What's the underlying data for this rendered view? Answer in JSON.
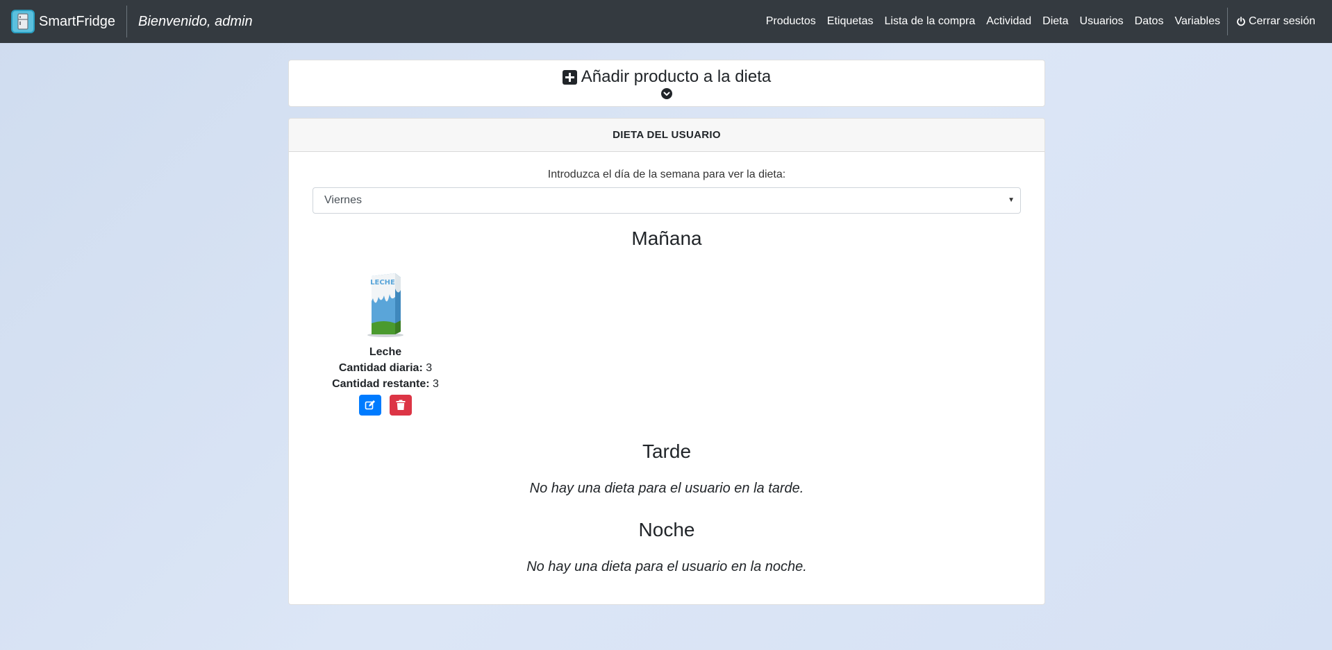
{
  "navbar": {
    "brand_name": "SmartFridge",
    "welcome": "Bienvenido, admin",
    "links": {
      "products": "Productos",
      "labels": "Etiquetas",
      "shopping_list": "Lista de la compra",
      "activity": "Actividad",
      "diet": "Dieta",
      "users": "Usuarios",
      "data": "Datos",
      "variables": "Variables"
    },
    "logout": "Cerrar sesión"
  },
  "add_panel": {
    "title": "Añadir producto a la dieta"
  },
  "diet": {
    "header": "DIETA DEL USUARIO",
    "select_label": "Introduzca el día de la semana para ver la dieta:",
    "selected_day": "Viernes",
    "morning": {
      "title": "Mañana",
      "product": {
        "name": "Leche",
        "image_label": "LECHE",
        "daily_label": "Cantidad diaria:",
        "daily_value": "3",
        "remaining_label": "Cantidad restante:",
        "remaining_value": "3"
      }
    },
    "afternoon": {
      "title": "Tarde",
      "empty": "No hay una dieta para el usuario en la tarde."
    },
    "night": {
      "title": "Noche",
      "empty": "No hay una dieta para el usuario en la noche."
    }
  },
  "colors": {
    "navbar": "#343a40",
    "edit_button": "#007bff",
    "delete_button": "#dc3545"
  }
}
